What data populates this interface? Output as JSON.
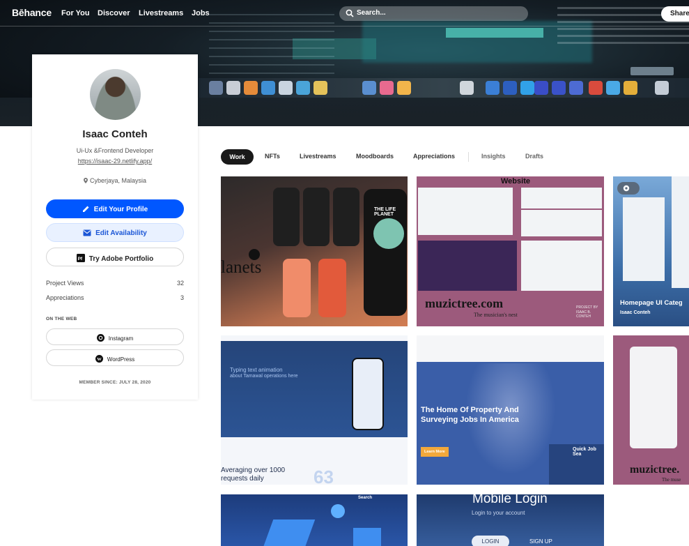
{
  "nav": {
    "logo": "Bēhance",
    "links": [
      "For You",
      "Discover",
      "Livestreams",
      "Jobs"
    ],
    "search_placeholder": "Search...",
    "share_label": "Share"
  },
  "profile": {
    "name": "Isaac Conteh",
    "role": "Ui-Ux &Frontend Developer",
    "website": "https://isaac-29.netlify.app/",
    "location": "Cyberjaya, Malaysia",
    "edit_profile_label": "Edit Your Profile",
    "edit_availability_label": "Edit Availability",
    "adobe_portfolio_label": "Try Adobe Portfolio",
    "stats": [
      {
        "label": "Project Views",
        "value": "32"
      },
      {
        "label": "Appreciations",
        "value": "3"
      }
    ],
    "on_the_web_label": "ON THE WEB",
    "social": [
      {
        "label": "Instagram",
        "icon": "instagram-icon"
      },
      {
        "label": "WordPress",
        "icon": "wordpress-icon"
      }
    ],
    "member_since": "MEMBER SINCE: JULY 28, 2020"
  },
  "tabs": {
    "active": "Work",
    "items": [
      "NFTs",
      "Livestreams",
      "Moodboards",
      "Appreciations",
      "Insights",
      "Drafts"
    ]
  },
  "projects": [
    {
      "id": "p1",
      "word": "lanets",
      "headline": "THE LIFE PLANET"
    },
    {
      "id": "p2",
      "heading": "Website",
      "brand": "muzictree.com",
      "tagline": "The musician's nest",
      "credit_1": "PROJECT BY",
      "credit_2": "ISAAC B. CONTEH"
    },
    {
      "id": "p3",
      "title": "Homepage UI Categ",
      "owner": "Isaac Conteh"
    },
    {
      "id": "p4",
      "headline": "Typing text animation",
      "headline_2": "about Tamawal operations here",
      "tagline": "Averaging over 1000",
      "tagline_2": "requests daily",
      "number": "63"
    },
    {
      "id": "p5",
      "headline": "The Home Of Property And",
      "headline_2": "Surveying Jobs In America",
      "cta": "Learn More",
      "search_label": "Quick Job Sea"
    },
    {
      "id": "p6",
      "brand": "muzictree.",
      "tagline": "The muse"
    },
    {
      "id": "p7",
      "heading": "Search"
    },
    {
      "id": "p8",
      "title": "Mobile Login",
      "subtitle": "Login to your account",
      "login_label": "LOGIN",
      "signup_label": "SIGN UP"
    }
  ]
}
